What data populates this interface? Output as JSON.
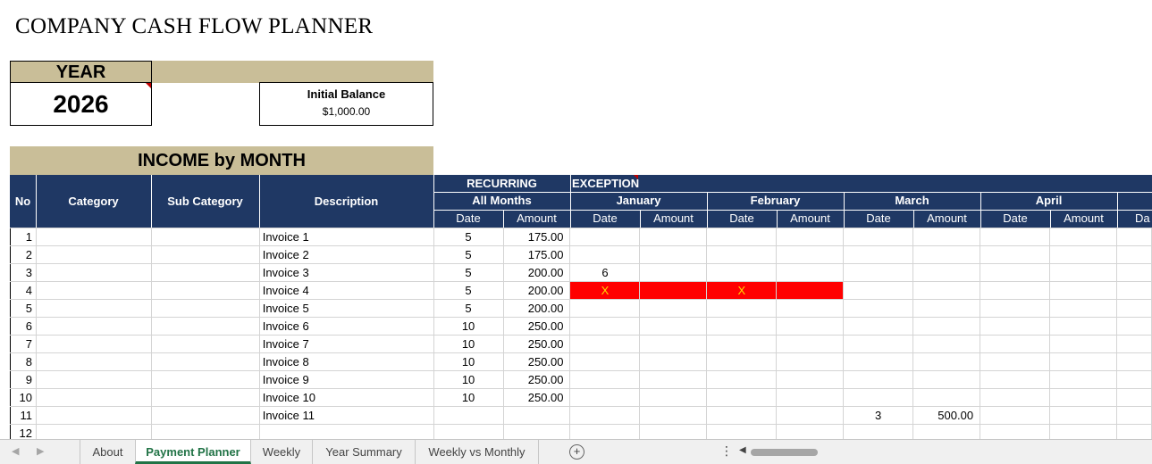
{
  "title": "COMPANY CASH FLOW PLANNER",
  "year": {
    "label": "YEAR",
    "value": "2026"
  },
  "initial_balance": {
    "label": "Initial Balance",
    "value": "$1,000.00"
  },
  "income_banner": "INCOME by MONTH",
  "header": {
    "no": "No",
    "category": "Category",
    "sub_category": "Sub Category",
    "description": "Description",
    "recurring": "RECURRING",
    "all_months": "All Months",
    "exception": "EXCEPTION",
    "months": [
      "January",
      "February",
      "March",
      "April"
    ],
    "date": "Date",
    "amount": "Amount",
    "date_partial": "Da"
  },
  "rows": [
    {
      "no": "1",
      "desc": "Invoice 1",
      "rdate": "5",
      "ramt": "175.00",
      "jan_date": "",
      "jan_x": false,
      "feb_x": false,
      "mar_date": "",
      "mar_amt": ""
    },
    {
      "no": "2",
      "desc": "Invoice 2",
      "rdate": "5",
      "ramt": "175.00",
      "jan_date": "",
      "jan_x": false,
      "feb_x": false,
      "mar_date": "",
      "mar_amt": ""
    },
    {
      "no": "3",
      "desc": "Invoice 3",
      "rdate": "5",
      "ramt": "200.00",
      "jan_date": "6",
      "jan_x": false,
      "feb_x": false,
      "mar_date": "",
      "mar_amt": ""
    },
    {
      "no": "4",
      "desc": "Invoice 4",
      "rdate": "5",
      "ramt": "200.00",
      "jan_date": "X",
      "jan_x": true,
      "feb_x": true,
      "feb_date": "X",
      "mar_date": "",
      "mar_amt": ""
    },
    {
      "no": "5",
      "desc": "Invoice 5",
      "rdate": "5",
      "ramt": "200.00",
      "jan_date": "",
      "jan_x": false,
      "feb_x": false,
      "mar_date": "",
      "mar_amt": ""
    },
    {
      "no": "6",
      "desc": "Invoice 6",
      "rdate": "10",
      "ramt": "250.00",
      "jan_date": "",
      "jan_x": false,
      "feb_x": false,
      "mar_date": "",
      "mar_amt": ""
    },
    {
      "no": "7",
      "desc": "Invoice 7",
      "rdate": "10",
      "ramt": "250.00",
      "jan_date": "",
      "jan_x": false,
      "feb_x": false,
      "mar_date": "",
      "mar_amt": ""
    },
    {
      "no": "8",
      "desc": "Invoice 8",
      "rdate": "10",
      "ramt": "250.00",
      "jan_date": "",
      "jan_x": false,
      "feb_x": false,
      "mar_date": "",
      "mar_amt": ""
    },
    {
      "no": "9",
      "desc": "Invoice 9",
      "rdate": "10",
      "ramt": "250.00",
      "jan_date": "",
      "jan_x": false,
      "feb_x": false,
      "mar_date": "",
      "mar_amt": ""
    },
    {
      "no": "10",
      "desc": "Invoice 10",
      "rdate": "10",
      "ramt": "250.00",
      "jan_date": "",
      "jan_x": false,
      "feb_x": false,
      "mar_date": "",
      "mar_amt": ""
    },
    {
      "no": "11",
      "desc": "Invoice 11",
      "rdate": "",
      "ramt": "",
      "jan_date": "",
      "jan_x": false,
      "feb_x": false,
      "mar_date": "3",
      "mar_amt": "500.00"
    },
    {
      "no": "12",
      "desc": "",
      "rdate": "",
      "ramt": "",
      "jan_date": "",
      "jan_x": false,
      "feb_x": false,
      "mar_date": "",
      "mar_amt": ""
    }
  ],
  "sheet_tabs": {
    "tabs": [
      "About",
      "Payment Planner",
      "Weekly",
      "Year Summary",
      "Weekly vs Monthly"
    ],
    "active": "Payment Planner",
    "add_symbol": "+",
    "more_symbol": "⋮"
  },
  "colors": {
    "header_navy": "#1f3864",
    "tan": "#c9be98",
    "exception_red": "#ff0000",
    "exception_text": "#ffd700",
    "active_tab": "#217346"
  },
  "icons": [
    "scroll-left-icon",
    "scroll-right-icon",
    "add-sheet-icon",
    "more-options-icon",
    "hscroll-left-icon"
  ]
}
